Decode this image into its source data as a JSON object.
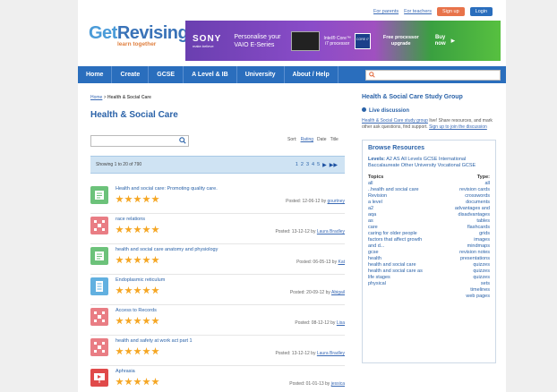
{
  "top_links": {
    "parents": "For parents",
    "teachers": "For teachers",
    "signup": "Sign up",
    "login": "Login"
  },
  "logo": {
    "get": "Get",
    "revising": "Revising",
    "tagline": "learn together"
  },
  "ad": {
    "brand": "SONY",
    "brand_sub": "make.believe",
    "text_line1": "Personalise your",
    "text_line2": "VAIO E-Series",
    "intel_line1": "Intel® Core™",
    "intel_line2": "i7 processor",
    "chip_label": "CORE i7",
    "offer_line1": "Free processor",
    "offer_line2": "upgrade",
    "buy_line1": "Buy",
    "buy_line2": "now",
    "arrow": "▸"
  },
  "nav": {
    "items": [
      "Home",
      "Create",
      "GCSE",
      "A Level & IB",
      "University",
      "About / Help"
    ],
    "search_icon": "search-icon"
  },
  "breadcrumb": {
    "home": "Home",
    "separator": " > ",
    "current": "Health & Social Care"
  },
  "page_title": "Health & Social Care",
  "search": {
    "button_icon": "search-icon",
    "button_glyph": "⚲"
  },
  "sort": {
    "label": "Sort:",
    "options": [
      "Rating",
      "Date",
      "Title"
    ]
  },
  "showing": "Showing 1 to 20 of 790",
  "pager": {
    "pages": [
      "1",
      "2",
      "3",
      "4",
      "5"
    ],
    "next": "▶",
    "last": "▶▶"
  },
  "resources": [
    {
      "title": "Health and social care: Promoting quality care.",
      "type": "note",
      "stars": 5,
      "posted_prefix": "Posted: 12-06-12 by ",
      "author": "gourtney"
    },
    {
      "title": "race relations",
      "type": "mindmap",
      "stars": 5,
      "posted_prefix": "Posted: 13-12-12 by ",
      "author": "Laura Bradley"
    },
    {
      "title": "health and social care anatomy and physiology",
      "type": "note",
      "stars": 5,
      "posted_prefix": "Posted: 06-05-13 by ",
      "author": "Kat"
    },
    {
      "title": "Endoplasmic reticulum",
      "type": "document",
      "stars": 5,
      "posted_prefix": "Posted: 20-09-12 by ",
      "author": "Abigail"
    },
    {
      "title": "Access to Records",
      "type": "mindmap",
      "stars": 5,
      "posted_prefix": "Posted: 08-12-12 by ",
      "author": "Lisa"
    },
    {
      "title": "health and safety at work act part 1",
      "type": "mindmap",
      "stars": 5,
      "posted_prefix": "Posted: 13-12-12 by ",
      "author": "Laura Bradley"
    },
    {
      "title": "Aphrasia",
      "type": "presentation",
      "stars": 5,
      "posted_prefix": "Posted: 01-01-13 by ",
      "author": "jessica"
    }
  ],
  "sidebar": {
    "heading": "Health & Social Care Study Group",
    "live_label": "Live discussion",
    "live_link": "Health & Social Care study group",
    "live_text_1": " live! Share resources, and mark other",
    "live_text_2": "ask questions, find support. ",
    "join_link": "Sign up to join the discussion",
    "browse_heading": "Browse Resources",
    "levels_label": "Levels:",
    "levels": [
      "A2",
      "AS",
      "All Levels",
      "GCSE",
      "International Baccalaureate",
      "Other",
      "University",
      "Vocational GCSE"
    ],
    "topics_label": "Topics",
    "topics": [
      "all",
      "..health and social care",
      "Revision",
      "a level",
      "a2",
      "aqa",
      "as",
      "care",
      "caring for older people",
      "factors that affect growth and d...",
      "gcse",
      "health",
      "health and social care",
      "health and social care as",
      "life stages",
      "physical"
    ],
    "types_label": "Type:",
    "types": [
      "all",
      "revision cards",
      "crosswords",
      "documents",
      "advantages and disadvantages",
      "tables",
      "flashcards",
      "grids",
      "images",
      "mindmaps",
      "revision notes",
      "presentations",
      "quizzes",
      "quizzes",
      "quizzes",
      "sets",
      "timelines",
      "web pages"
    ]
  },
  "colors": {
    "nav": "#2a6ebd",
    "accent": "#2a62a8",
    "star": "#f5a623",
    "signup": "#e8734a"
  }
}
